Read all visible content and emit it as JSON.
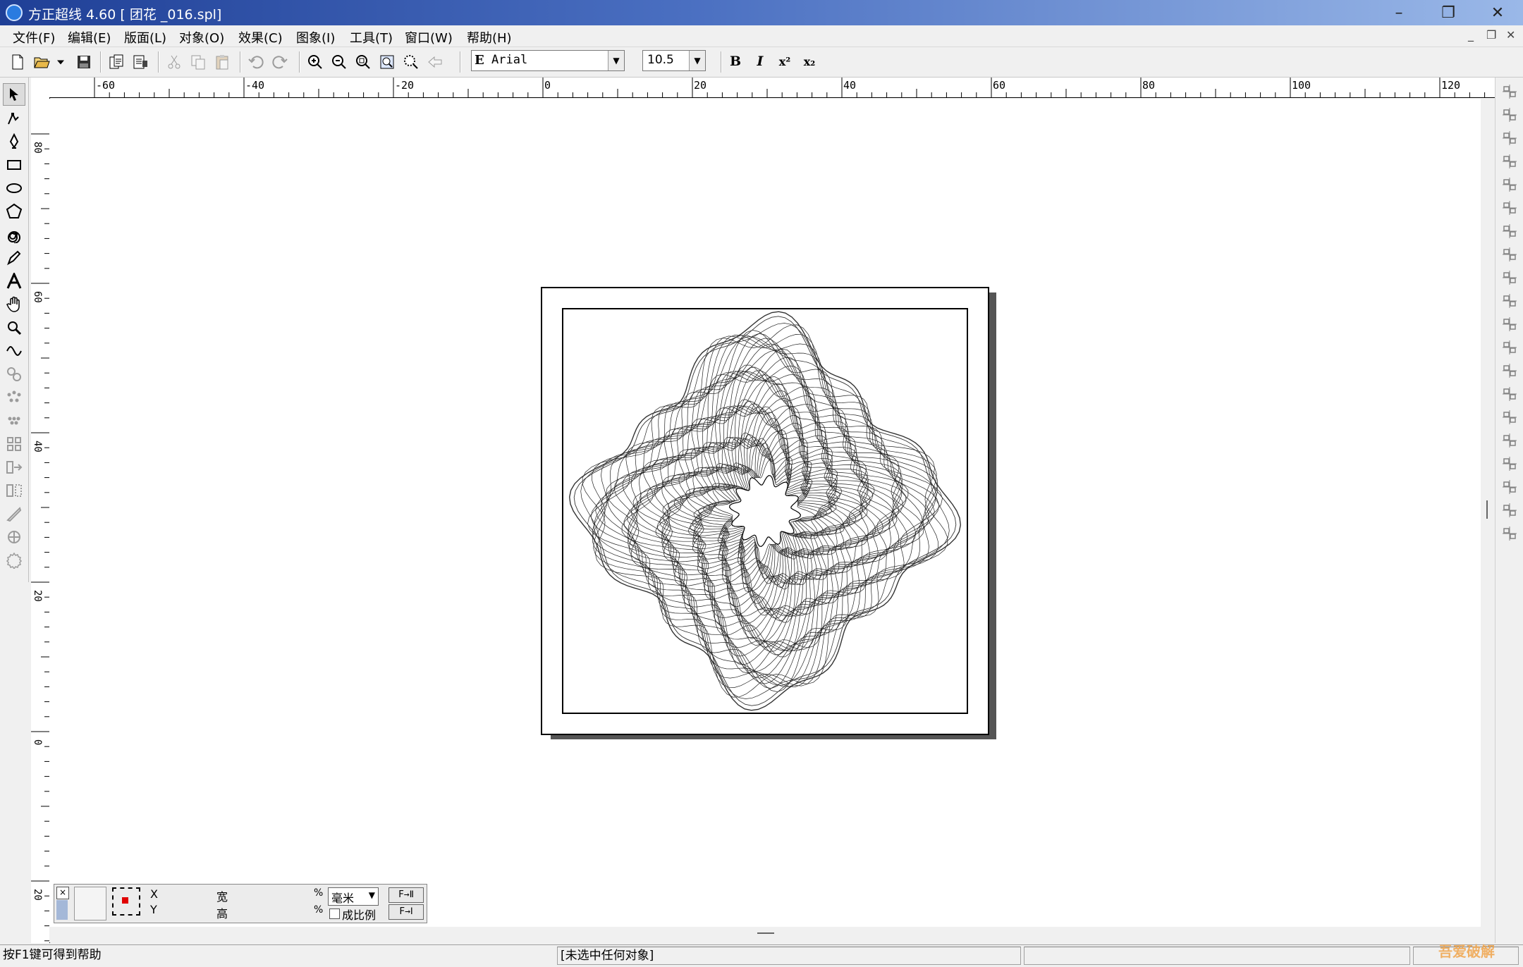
{
  "window": {
    "title": "方正超线 4.60  [ 团花 _016.spl]",
    "minimize": "–",
    "restore": "❐",
    "close": "✕"
  },
  "menu": [
    {
      "label": "文件(F)"
    },
    {
      "label": "编辑(E)"
    },
    {
      "label": "版面(L)"
    },
    {
      "label": "对象(O)"
    },
    {
      "label": "效果(C)"
    },
    {
      "label": "图象(I)"
    },
    {
      "label": "工具(T)"
    },
    {
      "label": "窗口(W)"
    },
    {
      "label": "帮助(H)"
    }
  ],
  "mdi_controls": {
    "minimize": "_",
    "restore": "❐",
    "close": "✕"
  },
  "toolbar": {
    "font_name": "Arial",
    "font_size": "10.5",
    "bold": "B",
    "italic": "I",
    "superscript": "x²",
    "subscript": "x₂"
  },
  "ruler": {
    "h_labels": [
      "-60",
      "-40",
      "-20",
      "0",
      "20",
      "40",
      "60",
      "80",
      "100",
      "120"
    ],
    "v_labels": [
      "80",
      "60",
      "40",
      "20",
      "0",
      "20"
    ]
  },
  "props_panel": {
    "close": "×",
    "x_label": "X",
    "y_label": "Y",
    "width_label": "宽",
    "height_label": "高",
    "pct1": "%",
    "pct2": "%",
    "unit": "毫米",
    "proportional": "成比例",
    "apply1": "F→Ⅱ",
    "apply2": "F→Ⅰ"
  },
  "status": {
    "help": "按F1键可得到帮助",
    "selection": "[未选中任何对象]"
  },
  "watermark": "吾爱破解",
  "colors": {
    "title_start": "#1f3f96",
    "title_end": "#9ab8e8",
    "accent_red": "#e00000"
  }
}
